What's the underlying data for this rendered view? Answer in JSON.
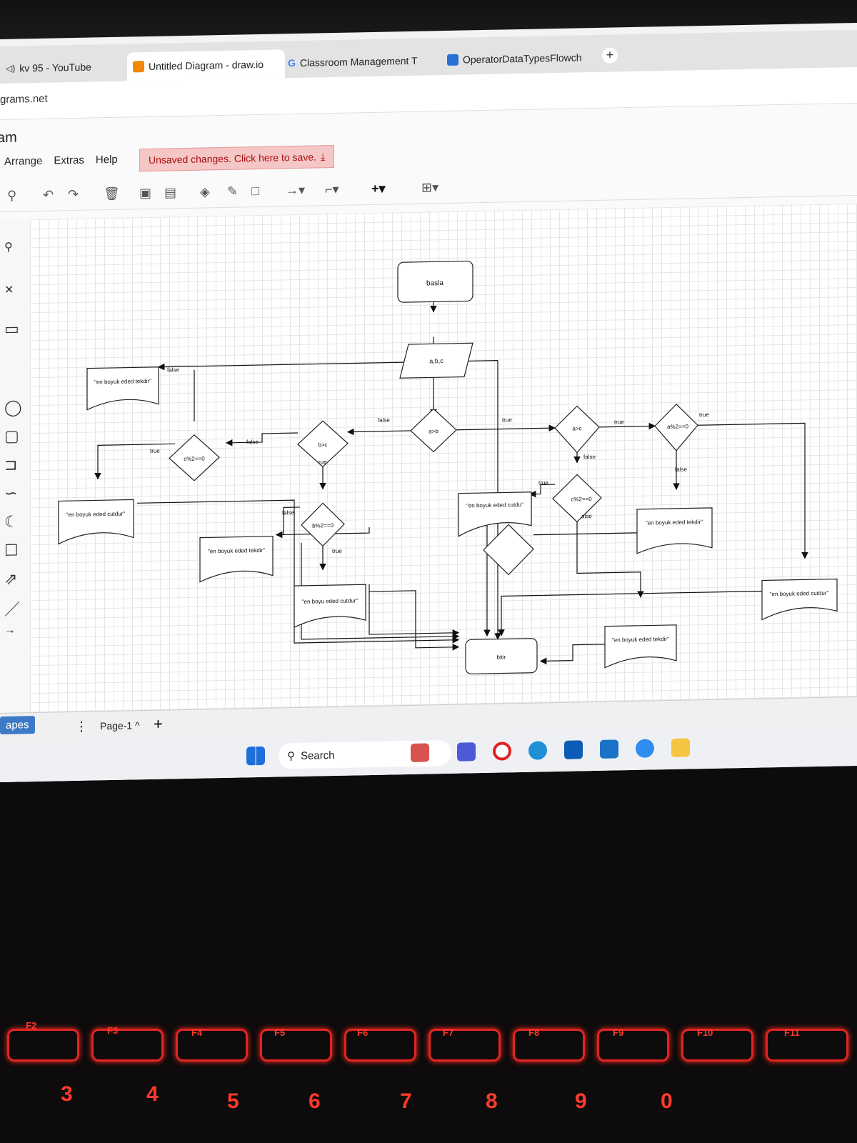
{
  "browser": {
    "tabs": [
      {
        "label": "kv 95 - YouTube"
      },
      {
        "label": "Untitled Diagram - draw.io"
      },
      {
        "label": "Classroom Management T"
      },
      {
        "label": "OperatorDataTypesFlowch"
      }
    ],
    "new_tab": "+",
    "url": "grams.net"
  },
  "app": {
    "title": "am",
    "menu": [
      "Arrange",
      "Extras",
      "Help"
    ],
    "unsaved": "Unsaved changes. Click here to save."
  },
  "diagram": {
    "basla": "basla",
    "input": "a,b,c",
    "dec_ab": "a>b",
    "dec_bc": "b>c",
    "dec_ac": "a>c",
    "dec_c2_left": "c%2==0",
    "dec_b2": "b%2==0",
    "dec_a2": "a%2==0",
    "dec_c2_right": "c%2==0",
    "doc_tekdir_1": "\"en boyuk eded tekdir\"",
    "doc_cutdur_1": "\"en boyuk eded cutdur\"",
    "doc_tekdir_2": "\"en boyuk eded tekdir\"",
    "doc_cutdur_2": "\"en boyu eded cutdur\"",
    "doc_cutdur_3": "\"en boyuk eded cutdu\"",
    "doc_tekdir_3": "\"en boyuk eded tekdir\"",
    "doc_cutdur_4": "\"en boyuk eded cutdur\"",
    "doc_tekdir_4": "\"en boyuk eded tekdir\"",
    "bitir": "bitir",
    "lbl_true": "true",
    "lbl_false": "false",
    "lbl_rue": "rue",
    "lbl_alse": "alse",
    "lbl_true_top": "true",
    "lbl_false_c2": "false"
  },
  "footer": {
    "shapes": "apes",
    "more": "⋮",
    "page": "Page-1 ^",
    "add": "+"
  },
  "taskbar": {
    "search": "Search"
  },
  "keyboard": {
    "fkeys": [
      "F2",
      "F3",
      "F4",
      "F5",
      "F6",
      "F7",
      "F8",
      "F9",
      "F10",
      "F11"
    ],
    "nums": [
      "3",
      "4",
      "5",
      "6",
      "7",
      "8",
      "9",
      "0"
    ]
  }
}
